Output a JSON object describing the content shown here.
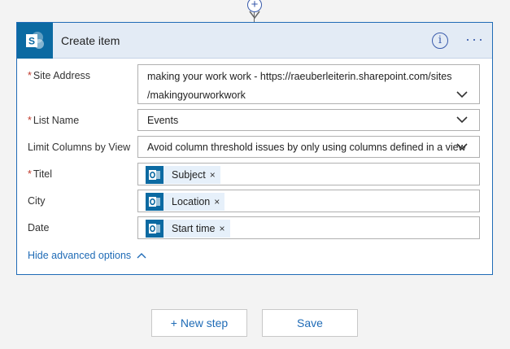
{
  "card": {
    "title": "Create item",
    "info_glyph": "i",
    "more_glyph": "···"
  },
  "fields": {
    "site_address": {
      "label": "Site Address",
      "value_line1": "making your work work - https://raeuberleiterin.sharepoint.com/sites",
      "value_line2": "/makingyourworkwork"
    },
    "list_name": {
      "label": "List Name",
      "value": "Events"
    },
    "limit_columns": {
      "label": "Limit Columns by View",
      "value": "Avoid column threshold issues by only using columns defined in a view"
    },
    "titel": {
      "label": "Titel",
      "token": "Subject"
    },
    "city": {
      "label": "City",
      "token": "Location"
    },
    "date": {
      "label": "Date",
      "token": "Start time"
    }
  },
  "advanced_link": "Hide advanced options",
  "buttons": {
    "new_step": "+ New step",
    "save": "Save"
  },
  "token_remove_glyph": "×",
  "required_mark": "*",
  "colors": {
    "accent": "#1f6bb6",
    "sharepoint": "#0b6aa2",
    "header_bg": "#e3ebf5",
    "token_bg": "#e6f0fa",
    "required": "#c0392b"
  },
  "icons": [
    "add-step-icon",
    "arrow-down-icon",
    "sharepoint-icon",
    "info-icon",
    "more-options-icon",
    "chevron-down-icon",
    "outlook-icon",
    "chevron-up-icon"
  ]
}
